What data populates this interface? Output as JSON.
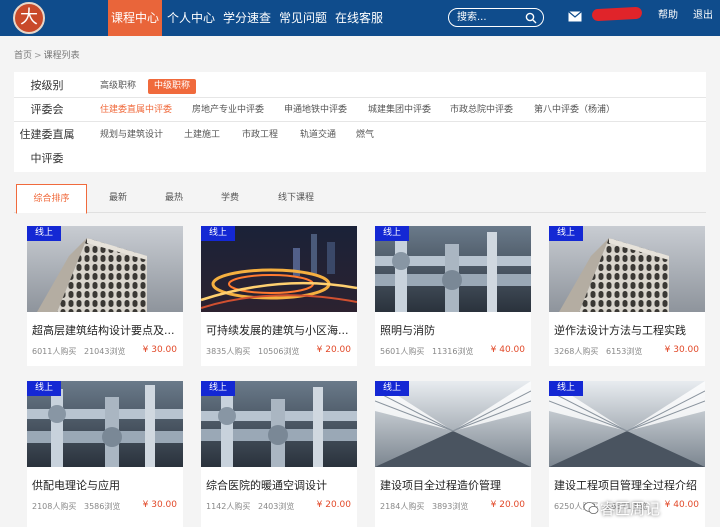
{
  "header": {
    "logo": "大",
    "nav": [
      "课程中心",
      "个人中心",
      "学分速查",
      "常见问题",
      "在线客服"
    ],
    "search_placeholder": "搜索...",
    "help": "帮助",
    "logout": "退出"
  },
  "breadcrumb": {
    "home": "首页",
    "separator": ">",
    "current": "课程列表"
  },
  "filters": {
    "level": {
      "label": "按级别",
      "options": [
        "高级职称",
        "中级职称"
      ]
    },
    "committee": {
      "label": "评委会",
      "options": [
        "住建委直属中评委",
        "房地产专业中评委",
        "申通地铁中评委",
        "城建集团中评委",
        "市政总院中评委",
        "第八中评委（杨浦）"
      ]
    },
    "direct": {
      "label1": "住建委直属",
      "label2": "中评委",
      "options": [
        "规划与建筑设计",
        "土建施工",
        "市政工程",
        "轨道交通",
        "燃气"
      ]
    }
  },
  "tabs": [
    "综合排序",
    "最新",
    "最热",
    "学费",
    "线下课程"
  ],
  "badge_label": "线上",
  "courses": [
    {
      "title": "超高层建筑结构设计要点及...",
      "buyers": "6011人购买",
      "views": "21043浏览",
      "price": "¥ 30.00",
      "image": "building-arches"
    },
    {
      "title": "可持续发展的建筑与小区海...",
      "buyers": "3835人购买",
      "views": "10506浏览",
      "price": "¥ 20.00",
      "image": "city-night"
    },
    {
      "title": "照明与消防",
      "buyers": "5601人购买",
      "views": "11316浏览",
      "price": "¥ 40.00",
      "image": "pipes"
    },
    {
      "title": "逆作法设计方法与工程实践",
      "buyers": "3268人购买",
      "views": "6153浏览",
      "price": "¥ 30.00",
      "image": "building-arches"
    },
    {
      "title": "供配电理论与应用",
      "buyers": "2108人购买",
      "views": "3586浏览",
      "price": "¥ 30.00",
      "image": "pipes"
    },
    {
      "title": "综合医院的暖通空调设计",
      "buyers": "1142人购买",
      "views": "2403浏览",
      "price": "¥ 20.00",
      "image": "pipes"
    },
    {
      "title": "建设项目全过程造价管理",
      "buyers": "2184人购买",
      "views": "3893浏览",
      "price": "¥ 20.00",
      "image": "hall"
    },
    {
      "title": "建设工程项目管理全过程介绍",
      "buyers": "6250人购买",
      "views": "16571浏览",
      "price": "¥ 40.00",
      "image": "hall"
    }
  ],
  "watermark": "睿匠周记",
  "colors": {
    "header": "#0f4c8c",
    "accent": "#f06a3c",
    "badge": "#1428d4",
    "price": "#e24a2a"
  }
}
